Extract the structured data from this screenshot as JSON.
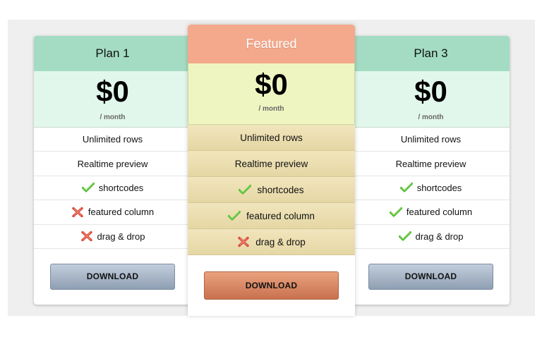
{
  "plans": [
    {
      "title": "Plan 1",
      "price": "$0",
      "period": "/ month",
      "features": [
        {
          "label": "Unlimited rows",
          "icon": "none"
        },
        {
          "label": "Realtime preview",
          "icon": "none"
        },
        {
          "label": "shortcodes",
          "icon": "check"
        },
        {
          "label": "featured column",
          "icon": "cross"
        },
        {
          "label": "drag & drop",
          "icon": "cross"
        }
      ],
      "button": "DOWNLOAD"
    },
    {
      "title": "Featured",
      "price": "$0",
      "period": "/ month",
      "features": [
        {
          "label": "Unlimited rows",
          "icon": "none"
        },
        {
          "label": "Realtime preview",
          "icon": "none"
        },
        {
          "label": "shortcodes",
          "icon": "check"
        },
        {
          "label": "featured column",
          "icon": "check"
        },
        {
          "label": "drag & drop",
          "icon": "cross"
        }
      ],
      "button": "DOWNLOAD"
    },
    {
      "title": "Plan 3",
      "price": "$0",
      "period": "/ month",
      "features": [
        {
          "label": "Unlimited rows",
          "icon": "none"
        },
        {
          "label": "Realtime preview",
          "icon": "none"
        },
        {
          "label": "shortcodes",
          "icon": "check"
        },
        {
          "label": "featured column",
          "icon": "check"
        },
        {
          "label": "drag & drop",
          "icon": "check"
        }
      ],
      "button": "DOWNLOAD"
    }
  ],
  "colors": {
    "side_header": "#a3dcc3",
    "side_price_bg": "#e2f7ec",
    "featured_header": "#f4a98c",
    "featured_price_bg": "#eff5c1",
    "featured_rows": "#ebddb0",
    "check": "#5cbf3a",
    "cross": "#d9483a"
  }
}
